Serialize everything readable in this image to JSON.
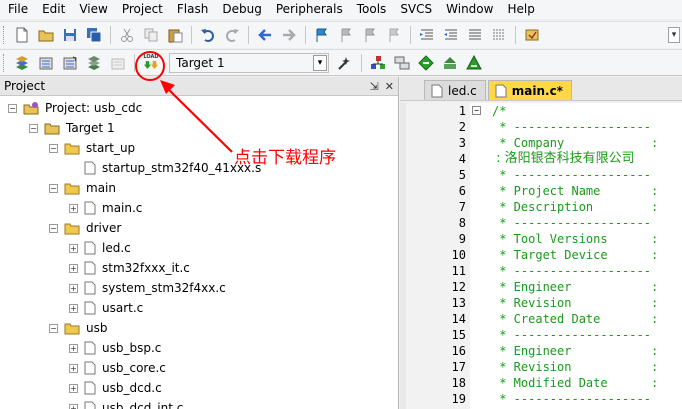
{
  "menu": [
    "File",
    "Edit",
    "View",
    "Project",
    "Flash",
    "Debug",
    "Peripherals",
    "Tools",
    "SVCS",
    "Window",
    "Help"
  ],
  "toolbar2": {
    "download_label": "LOAD",
    "target_value": "Target 1"
  },
  "project_panel": {
    "title": "Project",
    "pin": "⇲",
    "close": "✕",
    "tree": [
      {
        "label": "Project: usb_cdc",
        "level": 0,
        "kind": "project",
        "expander": "−"
      },
      {
        "label": "Target 1",
        "level": 1,
        "kind": "target",
        "expander": "−"
      },
      {
        "label": "start_up",
        "level": 2,
        "kind": "folder",
        "expander": "−"
      },
      {
        "label": "startup_stm32f40_41xxx.s",
        "level": 3,
        "kind": "file",
        "expander": ""
      },
      {
        "label": "main",
        "level": 2,
        "kind": "folder",
        "expander": "−"
      },
      {
        "label": "main.c",
        "level": 3,
        "kind": "cfile",
        "expander": "+"
      },
      {
        "label": "driver",
        "level": 2,
        "kind": "folder",
        "expander": "−"
      },
      {
        "label": "led.c",
        "level": 3,
        "kind": "cfile",
        "expander": "+"
      },
      {
        "label": "stm32fxxx_it.c",
        "level": 3,
        "kind": "cfile",
        "expander": "+"
      },
      {
        "label": "system_stm32f4xx.c",
        "level": 3,
        "kind": "cfile",
        "expander": "+"
      },
      {
        "label": "usart.c",
        "level": 3,
        "kind": "cfile",
        "expander": "+"
      },
      {
        "label": "usb",
        "level": 2,
        "kind": "folder",
        "expander": "−"
      },
      {
        "label": "usb_bsp.c",
        "level": 3,
        "kind": "cfile",
        "expander": "+"
      },
      {
        "label": "usb_core.c",
        "level": 3,
        "kind": "cfile",
        "expander": "+"
      },
      {
        "label": "usb_dcd.c",
        "level": 3,
        "kind": "cfile",
        "expander": "+"
      },
      {
        "label": "usb_dcd_int.c",
        "level": 3,
        "kind": "cfile",
        "expander": "+"
      }
    ]
  },
  "editor": {
    "tabs": [
      {
        "label": "led.c",
        "active": false
      },
      {
        "label": "main.c*",
        "active": true
      }
    ],
    "lines": [
      {
        "n": "1",
        "text": "/*",
        "fold": "−"
      },
      {
        "n": "2",
        "text": " * -------------------",
        "fold": ""
      },
      {
        "n": "3",
        "text": " * Company            :",
        "fold": ""
      },
      {
        "n": "4",
        "text": " : 洛阳银杏科技有限公司",
        "fold": ""
      },
      {
        "n": "5",
        "text": " * -------------------",
        "fold": ""
      },
      {
        "n": "6",
        "text": " * Project Name       :",
        "fold": ""
      },
      {
        "n": "7",
        "text": " * Description        :",
        "fold": ""
      },
      {
        "n": "8",
        "text": " * -------------------",
        "fold": ""
      },
      {
        "n": "9",
        "text": " * Tool Versions      :",
        "fold": ""
      },
      {
        "n": "10",
        "text": " * Target Device      :",
        "fold": ""
      },
      {
        "n": "11",
        "text": " * -------------------",
        "fold": ""
      },
      {
        "n": "12",
        "text": " * Engineer           :",
        "fold": ""
      },
      {
        "n": "13",
        "text": " * Revision           :",
        "fold": ""
      },
      {
        "n": "14",
        "text": " * Created Date       :",
        "fold": ""
      },
      {
        "n": "15",
        "text": " * -------------------",
        "fold": ""
      },
      {
        "n": "16",
        "text": " * Engineer           :",
        "fold": ""
      },
      {
        "n": "17",
        "text": " * Revision           :",
        "fold": ""
      },
      {
        "n": "18",
        "text": " * Modified Date      :",
        "fold": ""
      },
      {
        "n": "19",
        "text": " * -------------------",
        "fold": ""
      }
    ]
  },
  "annotation": {
    "text": "点击下载程序",
    "color": "#ff0000"
  },
  "colors": {
    "comment": "#1a9a1a",
    "active_tab": "#ffd84a",
    "annotation": "#ff0000"
  }
}
